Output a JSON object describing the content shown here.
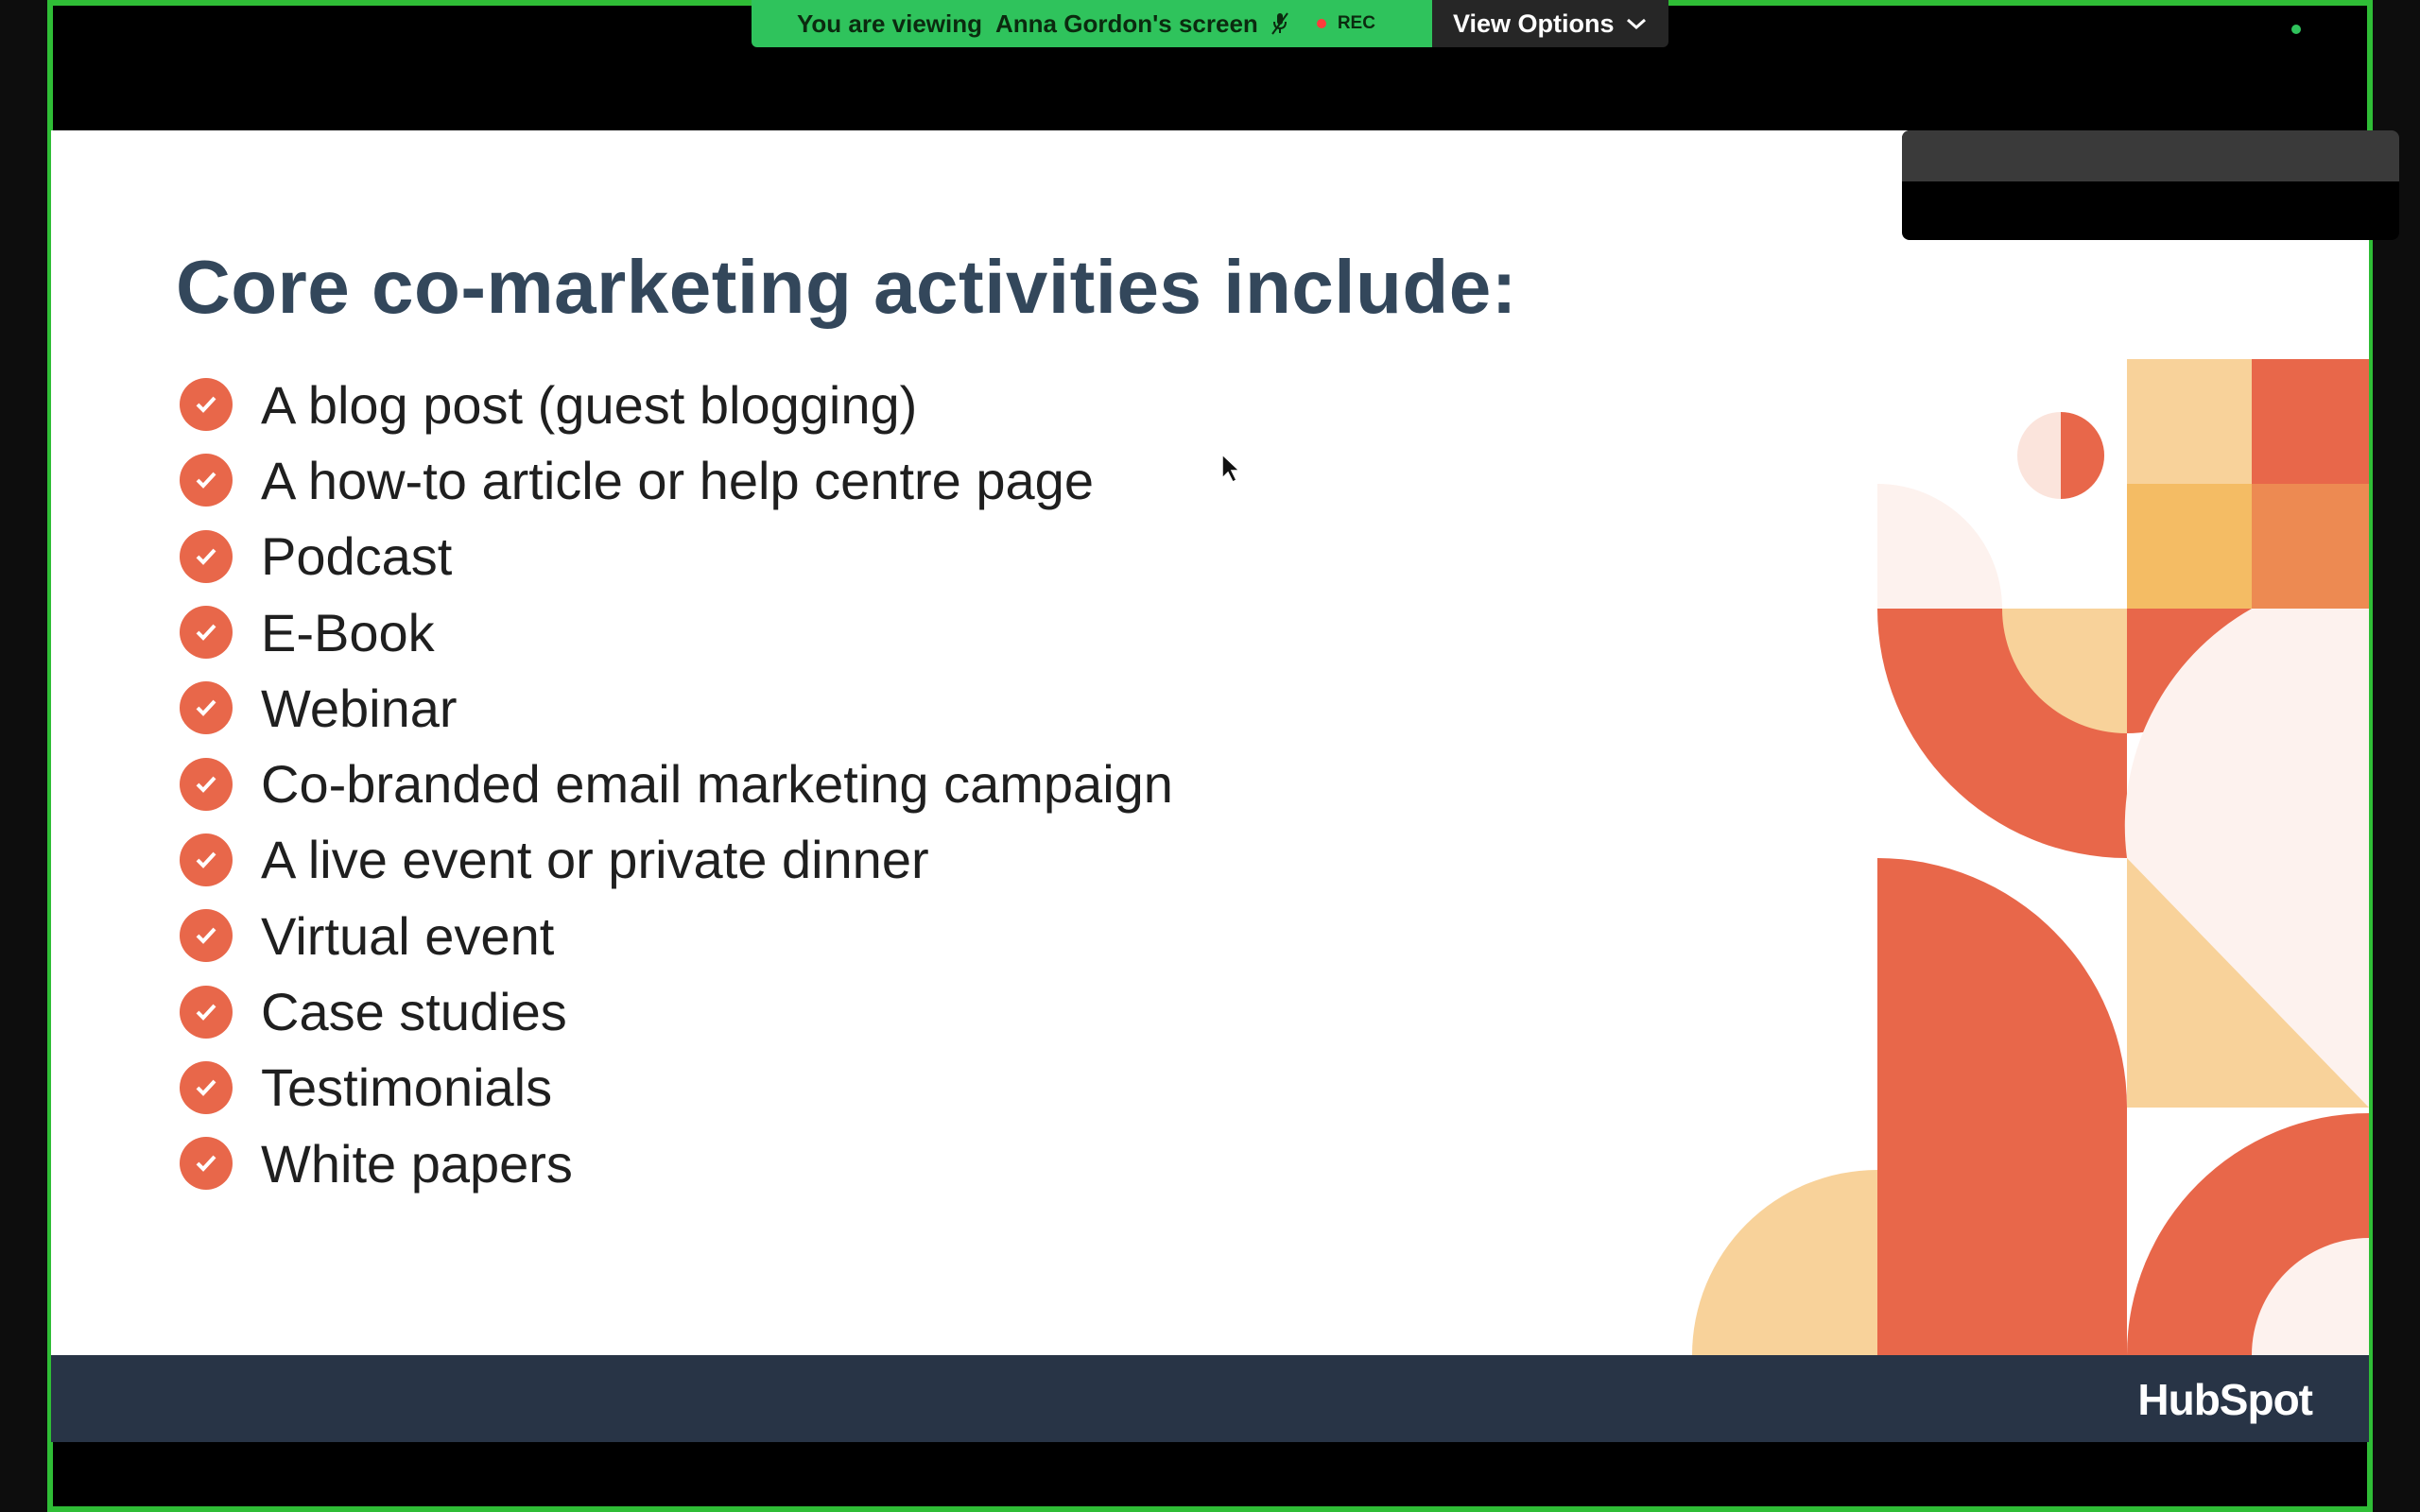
{
  "banner": {
    "viewing_prefix": "You are viewing",
    "presenter_screen": "Anna Gordon's screen",
    "rec_label": "REC",
    "view_options_label": "View Options",
    "icons": [
      "mute-icon",
      "rec-dot-icon",
      "chevron-down-icon"
    ]
  },
  "slide": {
    "title": "Core co-marketing activities include:",
    "items": [
      "A blog post (guest blogging)",
      "A how-to article or help centre page",
      "Podcast",
      "E-Book",
      "Webinar",
      "Co-branded email marketing campaign",
      "A live event or private dinner",
      "Virtual event",
      "Case studies",
      "Testimonials",
      "White papers"
    ],
    "logo_text": "HubSpot"
  },
  "colors": {
    "frame_border": "#2fbd36",
    "banner_green": "#2fc35c",
    "check_orange": "#e8674a",
    "title_slate": "#33475b",
    "footer_navy": "#283446",
    "art_peach": "#f6cc8a",
    "art_coral": "#e8674a",
    "art_orange": "#ed8a52",
    "art_gold": "#f4bc64",
    "art_blush": "#fdf2ee"
  }
}
